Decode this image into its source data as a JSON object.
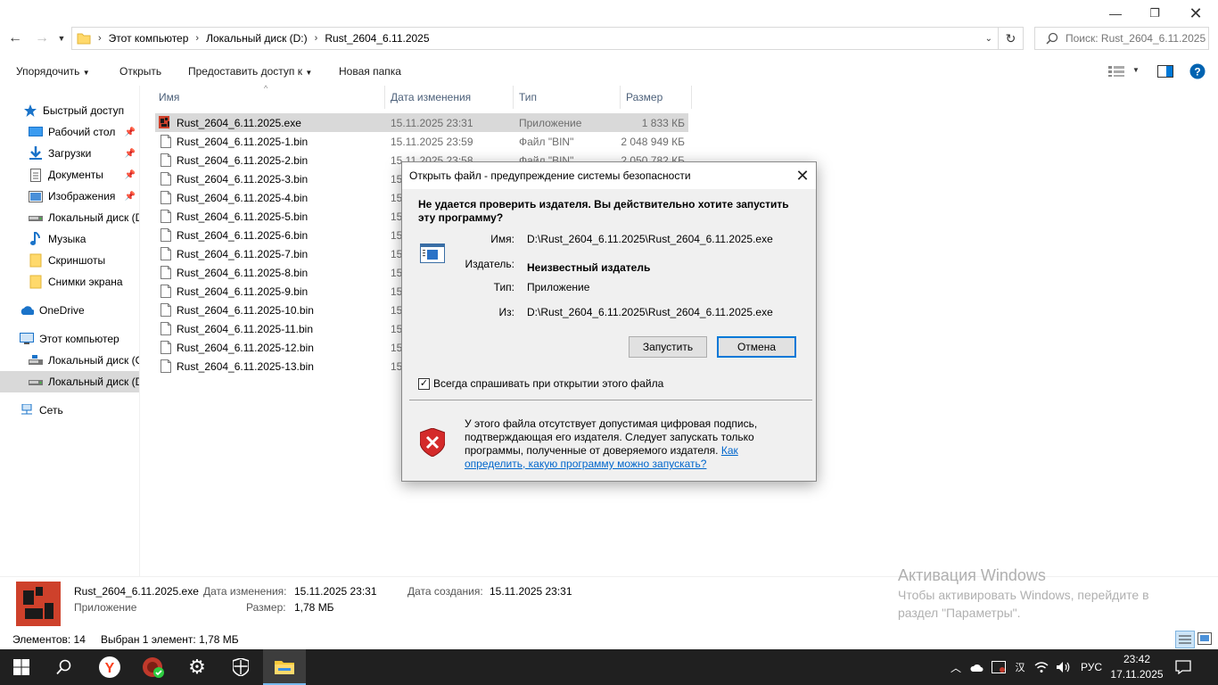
{
  "address": {
    "crumbs": [
      "Этот компьютер",
      "Локальный диск (D:)",
      "Rust_2604_6.11.2025"
    ],
    "search_placeholder": "Поиск: Rust_2604_6.11.2025"
  },
  "toolbar": {
    "organize": "Упорядочить",
    "open": "Открыть",
    "share": "Предоставить доступ к",
    "new_folder": "Новая папка"
  },
  "nav": {
    "quick_access": "Быстрый доступ",
    "items": [
      {
        "label": "Рабочий стол",
        "icon": "desktop-icon",
        "pinned": true
      },
      {
        "label": "Загрузки",
        "icon": "download-icon",
        "pinned": true
      },
      {
        "label": "Документы",
        "icon": "documents-icon",
        "pinned": true
      },
      {
        "label": "Изображения",
        "icon": "pictures-icon",
        "pinned": true
      },
      {
        "label": "Локальный диск (D:)",
        "icon": "drive-icon",
        "pinned": false
      },
      {
        "label": "Музыка",
        "icon": "music-icon",
        "pinned": false
      },
      {
        "label": "Скриншоты",
        "icon": "folder-icon",
        "pinned": false
      },
      {
        "label": "Снимки экрана",
        "icon": "folder-icon",
        "pinned": false
      }
    ],
    "onedrive": "OneDrive",
    "this_pc": "Этот компьютер",
    "drive_c": "Локальный диск (C:)",
    "drive_d": "Локальный диск (D:)",
    "network": "Сеть"
  },
  "columns": {
    "name": "Имя",
    "date": "Дата изменения",
    "type": "Тип",
    "size": "Размер"
  },
  "files": [
    {
      "name": "Rust_2604_6.11.2025.exe",
      "date": "15.11.2025 23:31",
      "type": "Приложение",
      "size": "1 833 КБ"
    },
    {
      "name": "Rust_2604_6.11.2025-1.bin",
      "date": "15.11.2025 23:59",
      "type": "Файл \"BIN\"",
      "size": "2 048 949 КБ"
    },
    {
      "name": "Rust_2604_6.11.2025-2.bin",
      "date": "15.11.2025 23:58",
      "type": "Файл \"BIN\"",
      "size": "2 050 782 КБ"
    },
    {
      "name": "Rust_2604_6.11.2025-3.bin",
      "date": "15",
      "type": "",
      "size": ""
    },
    {
      "name": "Rust_2604_6.11.2025-4.bin",
      "date": "15",
      "type": "",
      "size": ""
    },
    {
      "name": "Rust_2604_6.11.2025-5.bin",
      "date": "15",
      "type": "",
      "size": ""
    },
    {
      "name": "Rust_2604_6.11.2025-6.bin",
      "date": "15",
      "type": "",
      "size": ""
    },
    {
      "name": "Rust_2604_6.11.2025-7.bin",
      "date": "15",
      "type": "",
      "size": ""
    },
    {
      "name": "Rust_2604_6.11.2025-8.bin",
      "date": "15",
      "type": "",
      "size": ""
    },
    {
      "name": "Rust_2604_6.11.2025-9.bin",
      "date": "15",
      "type": "",
      "size": ""
    },
    {
      "name": "Rust_2604_6.11.2025-10.bin",
      "date": "15",
      "type": "",
      "size": ""
    },
    {
      "name": "Rust_2604_6.11.2025-11.bin",
      "date": "15",
      "type": "",
      "size": ""
    },
    {
      "name": "Rust_2604_6.11.2025-12.bin",
      "date": "15",
      "type": "",
      "size": ""
    },
    {
      "name": "Rust_2604_6.11.2025-13.bin",
      "date": "15",
      "type": "",
      "size": ""
    }
  ],
  "details": {
    "filename": "Rust_2604_6.11.2025.exe",
    "kind": "Приложение",
    "modified_label": "Дата изменения:",
    "modified": "15.11.2025 23:31",
    "size_label": "Размер:",
    "size": "1,78 МБ",
    "created_label": "Дата создания:",
    "created": "15.11.2025 23:31"
  },
  "status": {
    "count": "Элементов: 14",
    "selected": "Выбран 1 элемент: 1,78 МБ"
  },
  "watermark": {
    "title": "Активация Windows",
    "line1": "Чтобы активировать Windows, перейдите в",
    "line2": "раздел \"Параметры\"."
  },
  "dialog": {
    "title": "Открыть файл - предупреждение системы безопасности",
    "question": "Не удается проверить издателя.  Вы действительно хотите запустить эту программу?",
    "name_label": "Имя:",
    "name_value": "D:\\Rust_2604_6.11.2025\\Rust_2604_6.11.2025.exe",
    "publisher_label": "Издатель:",
    "publisher_value": "Неизвестный издатель",
    "type_label": "Тип:",
    "type_value": "Приложение",
    "from_label": "Из:",
    "from_value": "D:\\Rust_2604_6.11.2025\\Rust_2604_6.11.2025.exe",
    "run_button": "Запустить",
    "cancel_button": "Отмена",
    "always_ask": "Всегда спрашивать при открытии этого файла",
    "always_ask_checked": true,
    "warning_text": "У этого файла отсутствует допустимая цифровая подпись, подтверждающая его издателя.  Следует запускать только программы, полученные от доверяемого издателя.",
    "link_text": "Как определить, какую программу можно запускать?"
  },
  "taskbar": {
    "lang": "РУС",
    "time": "23:42",
    "date": "17.11.2025"
  },
  "colors": {
    "accent": "#0078d7",
    "taskbar": "#202020",
    "selection": "#d9d9d9",
    "rust_red": "#ce412b"
  }
}
